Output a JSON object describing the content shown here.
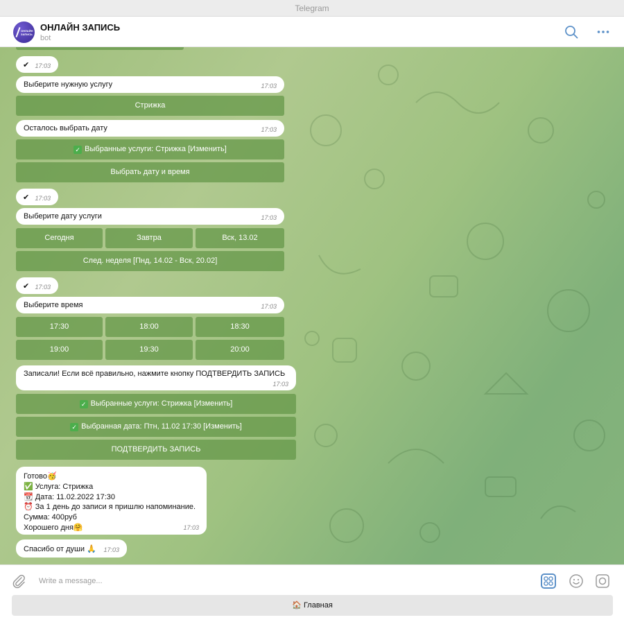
{
  "window": {
    "title": "Telegram"
  },
  "chat": {
    "name": "ОНЛАЙН ЗАПИСЬ",
    "status": "bot",
    "avatar_line1": "ОНЛАЙН",
    "avatar_line2": "ЗАПИСЬ"
  },
  "messages": {
    "m1": {
      "text": "✔",
      "time": "17:03"
    },
    "m2": {
      "text": "Выберите нужную услугу",
      "time": "17:03"
    },
    "m3": {
      "text": "Осталось выбрать дату",
      "time": "17:03"
    },
    "m4": {
      "text": "✔",
      "time": "17:03"
    },
    "m5": {
      "text": "Выберите дату услуги",
      "time": "17:03"
    },
    "m6": {
      "text": "✔",
      "time": "17:03"
    },
    "m7": {
      "text": "Выберите время",
      "time": "17:03"
    },
    "m8": {
      "text": "Записали! Если всё правильно, нажмите кнопку ПОДТВЕРДИТЬ ЗАПИСЬ",
      "time": "17:03"
    },
    "m9": {
      "lines": [
        "Готово🥳",
        "✅ Услуга: Стрижка",
        "📆 Дата: 11.02.2022 17:30",
        "⏰ За 1 день до записи я пришлю напоминание.",
        "Сумма: 400руб",
        "Хорошего дня🤗"
      ],
      "time": "17:03"
    },
    "m10": {
      "text": "Спасибо от души 🙏",
      "time": "17:03"
    }
  },
  "keyboards": {
    "service": [
      "Стрижка"
    ],
    "summary1": {
      "check": "✓",
      "selected": "Выбранные услуги: Стрижка [Изменить]",
      "pick": "Выбрать дату и время"
    },
    "dates": [
      "Сегодня",
      "Завтра",
      "Вск, 13.02"
    ],
    "next_week": "След. неделя [Пнд, 14.02 - Вск, 20.02]",
    "times": [
      "17:30",
      "18:00",
      "18:30",
      "19:00",
      "19:30",
      "20:00"
    ],
    "summary2": {
      "check": "✓",
      "selected_services": "Выбранные услуги: Стрижка [Изменить]",
      "selected_date": "Выбранная дата: Птн, 11.02 17:30 [Изменить]",
      "confirm": "ПОДТВЕРДИТЬ ЗАПИСЬ"
    }
  },
  "input": {
    "placeholder": "Write a message..."
  },
  "bottom_button": {
    "label": "🏠 Главная"
  },
  "colors": {
    "accent": "#5b90c8",
    "keyboard_button": "#6a9a4f",
    "bubble": "#ffffff"
  }
}
